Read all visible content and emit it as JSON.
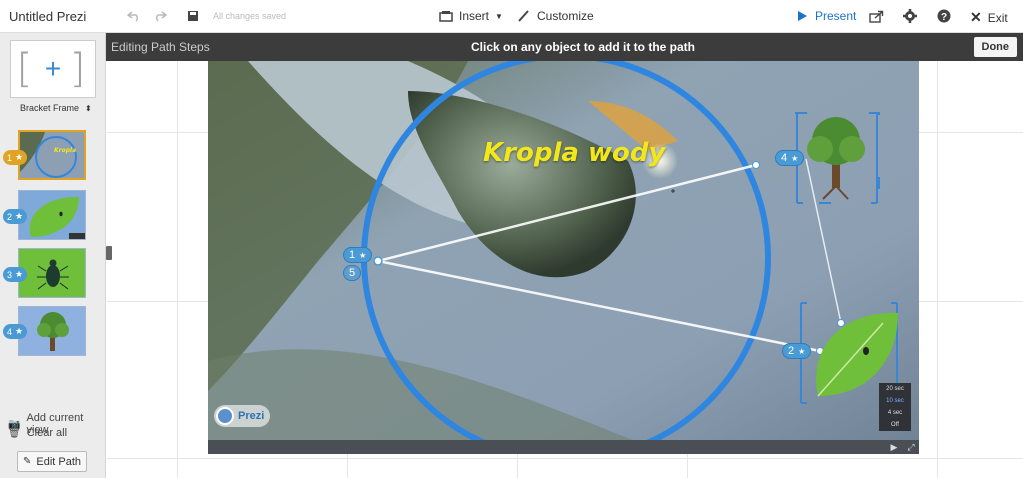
{
  "app": {
    "title": "Untitled Prezi",
    "saved_status": "All changes saved"
  },
  "toolbar": {
    "insert_label": "Insert",
    "customize_label": "Customize",
    "present_label": "Present",
    "exit_label": "Exit"
  },
  "editing_bar": {
    "mode_label": "Editing Path Steps",
    "instruction": "Click on any object to add it to the path",
    "done_label": "Done"
  },
  "sidebar": {
    "frame_selector_label": "Bracket Frame",
    "thumbnails": [
      {
        "step": "1",
        "content": "water-drop",
        "active": true
      },
      {
        "step": "2",
        "content": "leaf",
        "active": false
      },
      {
        "step": "3",
        "content": "beetle",
        "active": false
      },
      {
        "step": "4",
        "content": "tree",
        "active": false
      }
    ],
    "add_current_view_label": "Add current view",
    "clear_all_label": "Clear all",
    "edit_path_label": "Edit Path"
  },
  "canvas": {
    "headline": "Kropla wody",
    "logo_text": "Prezi",
    "path_badges": [
      {
        "id": "1",
        "label": "1"
      },
      {
        "id": "5",
        "label": "5"
      },
      {
        "id": "4",
        "label": "4"
      },
      {
        "id": "2",
        "label": "2"
      }
    ],
    "timing_options": [
      "20 sec",
      "10 sec",
      "4 sec",
      "Off"
    ],
    "timing_selected": "10 sec"
  },
  "colors": {
    "accent": "#1a73c9",
    "path_blue": "#4a9ad4",
    "active_step": "#e1a325",
    "circle_frame": "#2f86e0",
    "headline": "#f2e71b"
  }
}
